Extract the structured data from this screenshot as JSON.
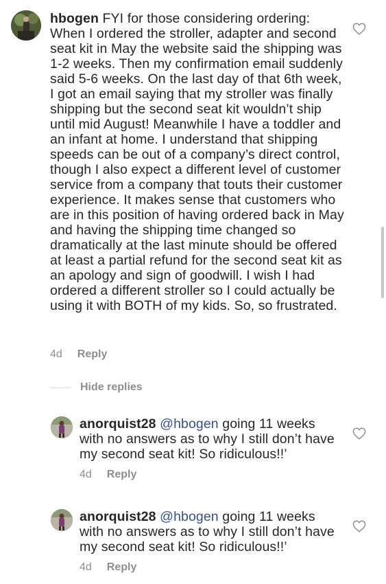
{
  "main_comment": {
    "username": "hbogen",
    "body": "FYI for those considering ordering: When I ordered the stroller, adapter and second seat kit in May the website said the shipping was 1-2 weeks. Then my confirmation email suddenly said 5-6 weeks. On the last day of that 6th week, I got an email saying that my stroller was finally shipping but the second seat kit wouldn’t ship until mid August! Meanwhile I have a toddler and an infant at home. I understand that shipping speeds can be out of a company’s direct control, though I also expect a different level of customer service from a company that touts their customer experience. It makes sense that customers who are in this position of having ordered back in May and having the shipping time changed so dramatically at the last minute should be offered at least a partial refund for the second seat kit as an apology and sign of goodwill. I wish I had ordered a different stroller so I could actually be using it with BOTH of my kids. So, so frustrated.",
    "time": "4d",
    "reply_label": "Reply"
  },
  "hide_replies_label": "Hide replies",
  "replies": [
    {
      "username": "anorquist28",
      "mention": "@hbogen",
      "body": "going 11 weeks with no answers as to why I still don’t have my second seat kit! So ridiculous!!’",
      "time": "4d",
      "reply_label": "Reply"
    },
    {
      "username": "anorquist28",
      "mention": "@hbogen",
      "body": "going 11 weeks with no answers as to why I still don’t have my second seat kit! So ridiculous!!’",
      "time": "4d",
      "reply_label": "Reply"
    }
  ]
}
